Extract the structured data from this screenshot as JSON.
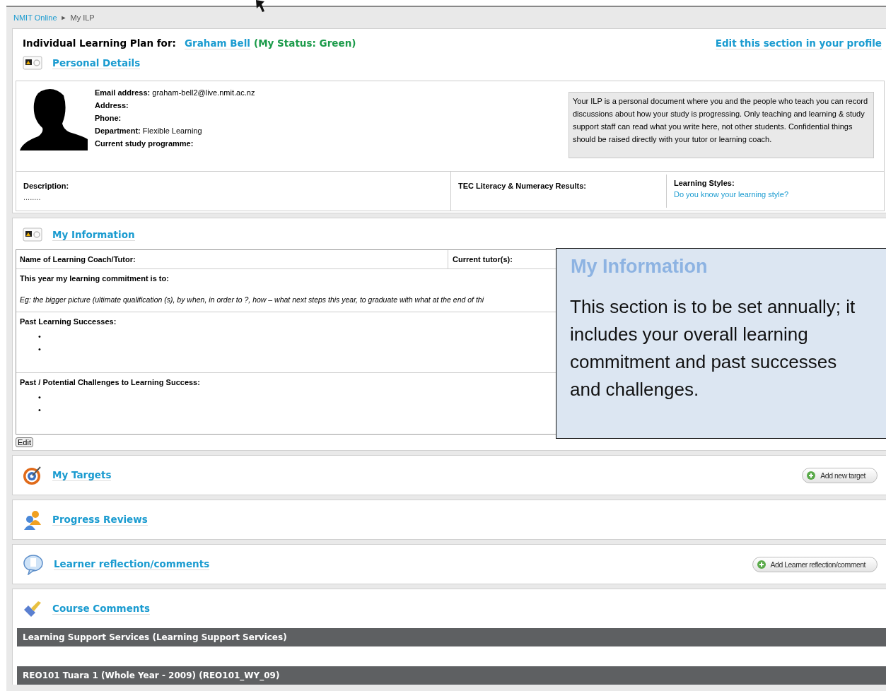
{
  "breadcrumb": {
    "link": "NMIT Online",
    "separator": "►",
    "current": "My ILP"
  },
  "header": {
    "label": "Individual Learning Plan for:",
    "name": "Graham Bell",
    "status": "(My Status: Green)",
    "edit_link": "Edit this section in your profile"
  },
  "personal_details": {
    "title": "Personal Details",
    "fields": [
      {
        "label": "Email address:",
        "value": "graham-bell2@live.nmit.ac.nz"
      },
      {
        "label": "Address:"
      },
      {
        "label": "Phone:"
      },
      {
        "label": "Department:",
        "value": "Flexible Learning"
      },
      {
        "label": "Current study programme:"
      }
    ],
    "note": "Your ILP is a personal document where you and the people who teach you can record discussions about how your study is progressing. Only teaching and learning & study support staff can read what you write here, not other students. Confidential things should be raised directly with your tutor or learning coach.",
    "description_label": "Description:",
    "description_value": "........",
    "tec_label": "TEC Literacy & Numeracy Results:",
    "styles_label": "Learning Styles:",
    "styles_link": "Do you know your learning style?"
  },
  "my_information": {
    "title": "My Information",
    "coach_label": "Name of Learning Coach/Tutor:",
    "tutor_label": "Current tutor(s):",
    "commitment_label": "This year my learning commitment is to:",
    "commitment_hint": "Eg: the bigger picture (ultimate qualification (s), by when, in order to ?, how – what next steps this year, to graduate with what at the end of thi",
    "successes_label": "Past Learning Successes:",
    "challenges_label": "Past / Potential Challenges to Learning Success:",
    "bullets": [
      "•",
      "•"
    ],
    "edit_button": "Edit"
  },
  "sections": [
    {
      "kind": "targets",
      "title": "My Targets",
      "button": "Add new target"
    },
    {
      "kind": "reviews",
      "title": "Progress Reviews"
    },
    {
      "kind": "reflection",
      "title": "Learner reflection/comments",
      "button": "Add Learner reflection/comment"
    }
  ],
  "course_comments": {
    "title": "Course Comments",
    "courses": [
      "Learning Support Services (Learning Support Services)",
      "REO101 Tuara 1 (Whole Year - 2009) (REO101_WY_09)"
    ]
  },
  "callout": {
    "title": "My Information",
    "text": "This section is to be set annually; it includes your overall learning commitment and past successes and challenges."
  }
}
